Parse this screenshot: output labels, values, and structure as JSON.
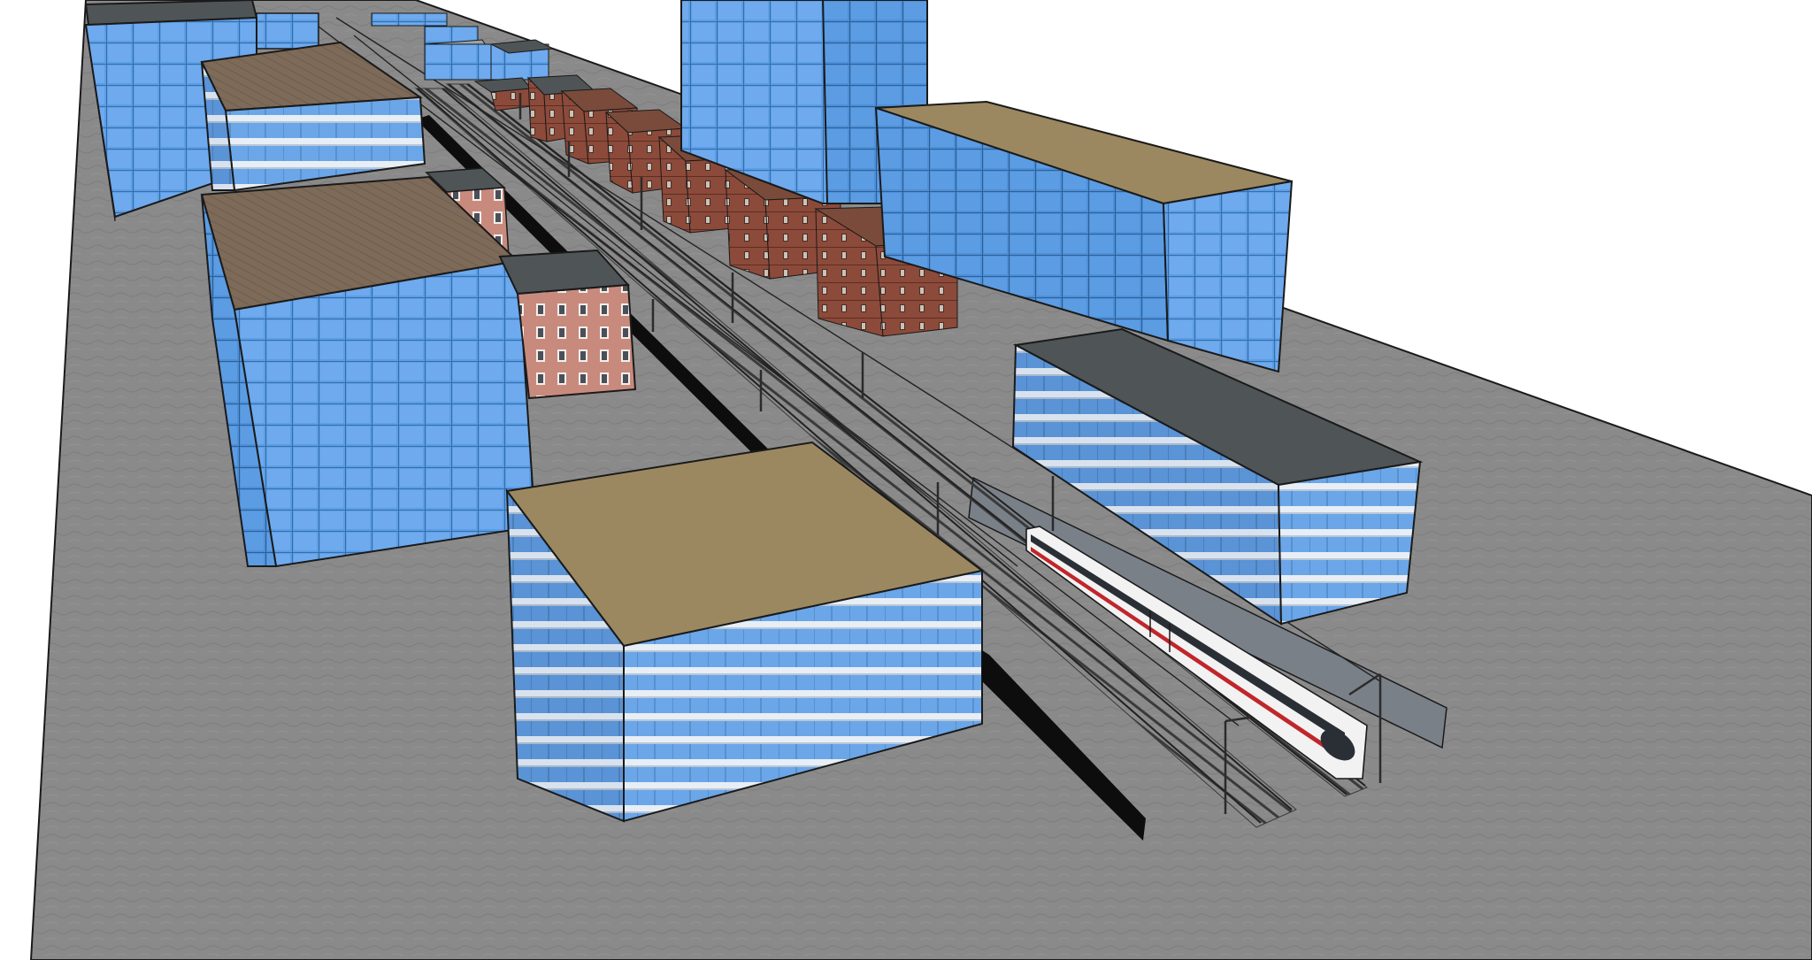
{
  "viewport": {
    "background_color": "#ffffff",
    "ground_color": "#8a8a8a",
    "edge_color": "#1a1a1a"
  },
  "materials": {
    "glass_blue": "#5b9ee6",
    "glass_blue_light": "#8fc2f2",
    "glass_grid": "#2f5f95",
    "roof_brown": "#7d6a58",
    "roof_tan": "#9c8860",
    "roof_slate": "#4f5457",
    "brick_red": "#8c4a3a",
    "brick_pink": "#c98a7e",
    "band_white": "#e8eef5",
    "shadow": "#0d0d0d",
    "rail": "#3a3a3a",
    "train_white": "#f2f2f2",
    "train_red": "#c0262b",
    "train_window": "#2a2f36",
    "catenary_pole": "#2b2b2b"
  },
  "scene_objects": {
    "buildings": [
      "tower-glass-far-left",
      "office-brown-roof-left",
      "block-glass-left-large",
      "building-red-facade",
      "building-small-left",
      "tower-glass-back-center",
      "block-glass-right-tan-roof",
      "office-striped-right",
      "office-striped-front",
      "brick-row-buildings",
      "distant-buildings"
    ],
    "rail_elements": [
      "railway-track",
      "catenary-poles",
      "overhead-wire",
      "noise-barrier",
      "high-speed-train"
    ]
  }
}
